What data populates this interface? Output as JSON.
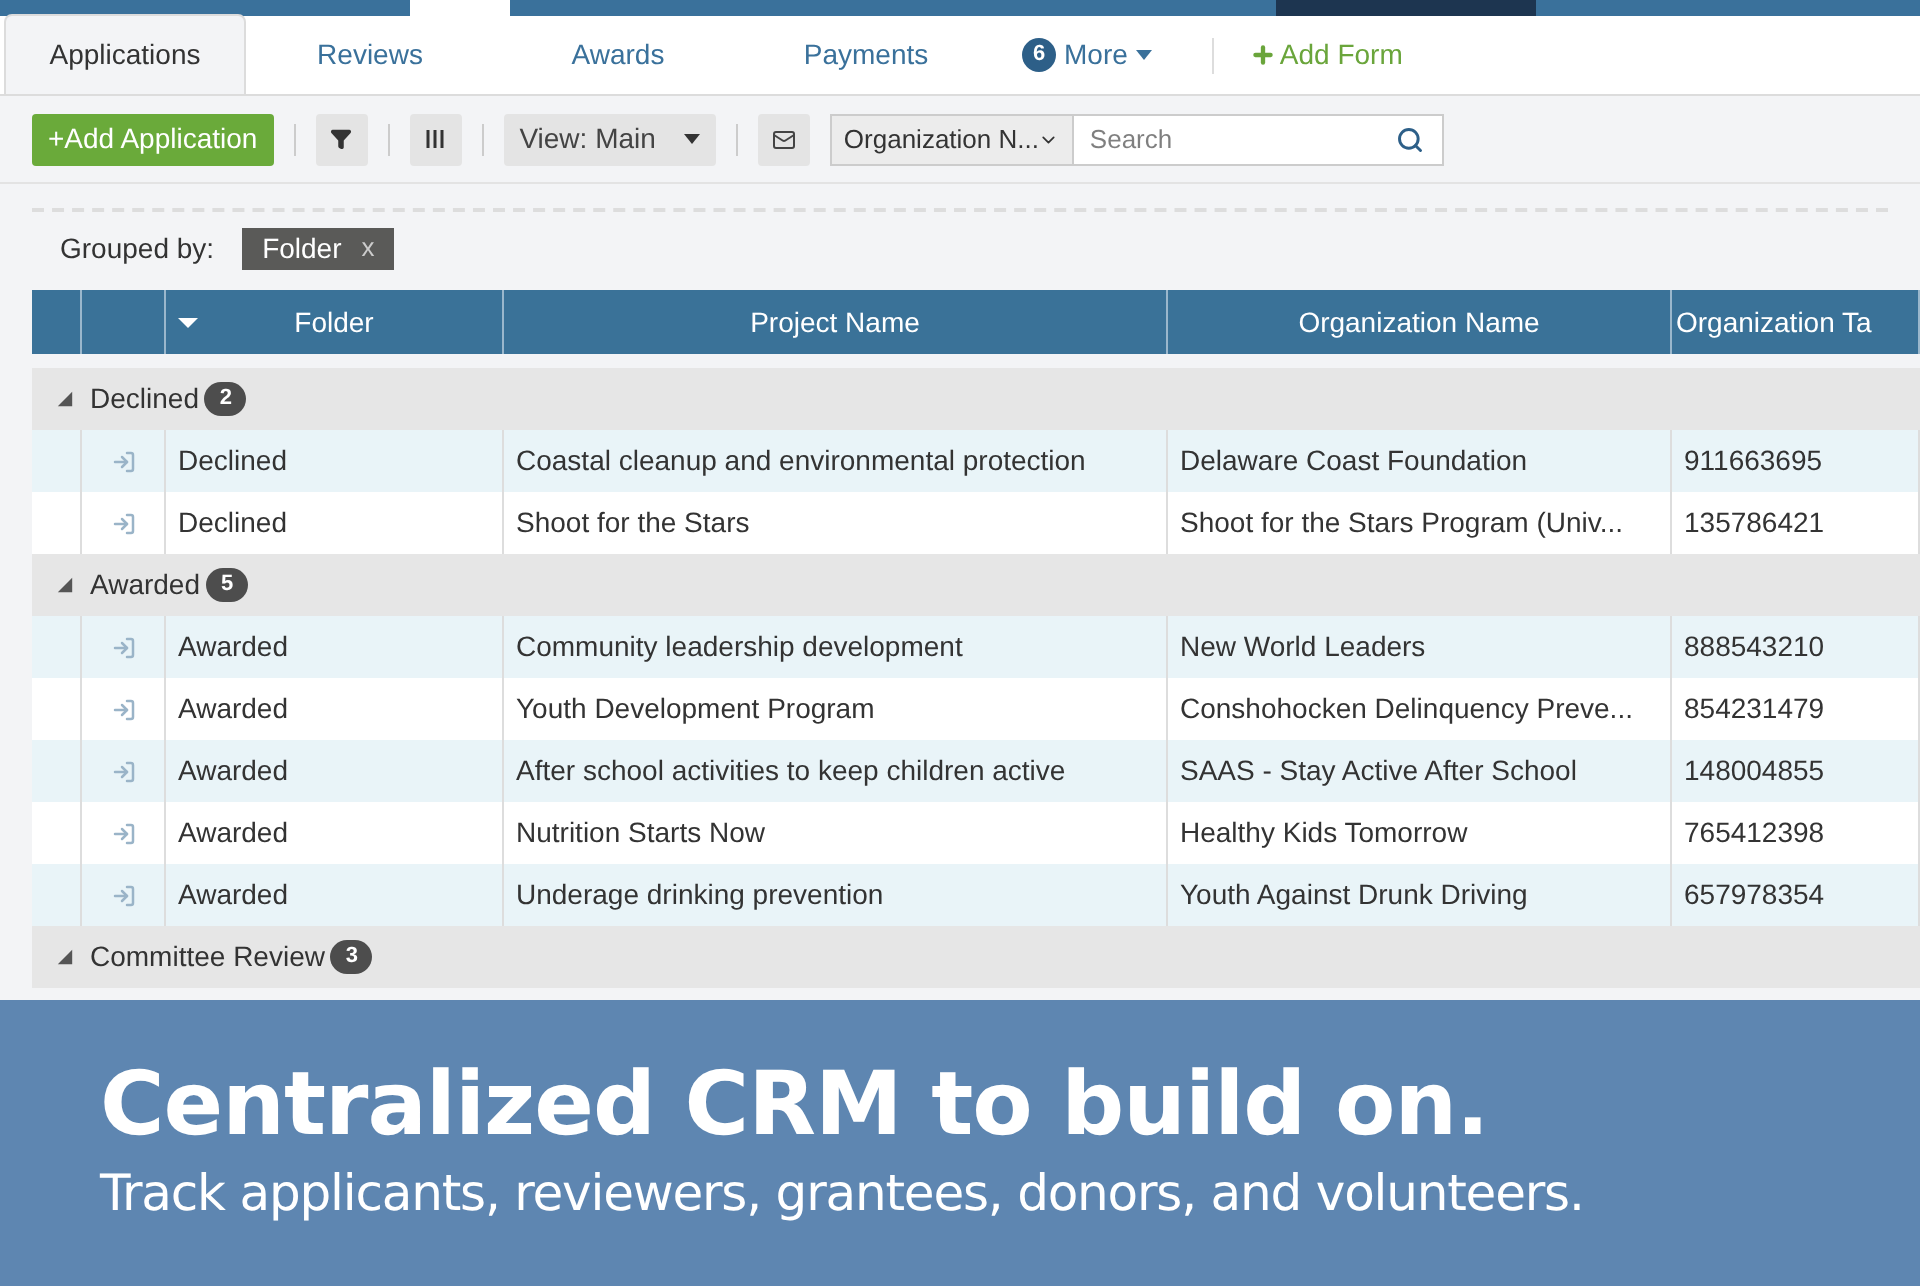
{
  "tabs": [
    {
      "label": "Applications",
      "selected": true
    },
    {
      "label": "Reviews",
      "selected": false
    },
    {
      "label": "Awards",
      "selected": false
    },
    {
      "label": "Payments",
      "selected": false
    }
  ],
  "more": {
    "count": "6",
    "label": "More"
  },
  "add_form": "Add Form",
  "toolbar": {
    "add_button": "+Add Application",
    "view": "View: Main",
    "filter_field": "Organization N...",
    "search": {
      "placeholder": "Search"
    }
  },
  "grouped_by": {
    "label": "Grouped by:",
    "chip": "Folder",
    "remove": "x"
  },
  "table": {
    "columns": [
      "Folder",
      "Project Name",
      "Organization Name",
      "Organization Ta"
    ],
    "groups": [
      {
        "name": "Declined",
        "count": "2",
        "expanded": true,
        "rows": [
          [
            "Declined",
            "Coastal cleanup and environmental protection",
            "Delaware Coast Foundation",
            "911663695"
          ],
          [
            "Declined",
            "Shoot for the Stars",
            "Shoot for the Stars Program (Univ...",
            "135786421"
          ]
        ]
      },
      {
        "name": "Awarded",
        "count": "5",
        "expanded": true,
        "rows": [
          [
            "Awarded",
            "Community leadership development",
            "New World Leaders",
            "888543210"
          ],
          [
            "Awarded",
            "Youth Development Program",
            "Conshohocken Delinquency Preve...",
            "854231479"
          ],
          [
            "Awarded",
            "After school activities to keep children active",
            "SAAS - Stay Active After School",
            "148004855"
          ],
          [
            "Awarded",
            "Nutrition Starts Now",
            "Healthy Kids Tomorrow",
            "765412398"
          ],
          [
            "Awarded",
            "Underage drinking prevention",
            "Youth Against Drunk Driving",
            "657978354"
          ]
        ]
      },
      {
        "name": "Committee Review",
        "count": "3",
        "expanded": true
      }
    ]
  },
  "banner": {
    "headline": "Centralized CRM to build on.",
    "subline": "Track applicants, reviewers, grantees, donors, and volunteers."
  }
}
